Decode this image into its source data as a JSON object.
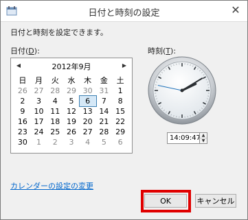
{
  "window": {
    "title": "日付と時刻の設定",
    "close_glyph": "✕"
  },
  "instruction": "日付と時刻を設定できます。",
  "date_label": {
    "text": "日付(",
    "accel": "D",
    "tail": "):"
  },
  "time_label": {
    "text": "時刻(",
    "accel": "T",
    "tail": "):"
  },
  "calendar": {
    "month_title": "2012年9月",
    "prev_glyph": "◀",
    "next_glyph": "▶",
    "weekdays": [
      "日",
      "月",
      "火",
      "水",
      "木",
      "金",
      "土"
    ],
    "weeks": [
      [
        "26",
        "27",
        "28",
        "29",
        "30",
        "31",
        "1"
      ],
      [
        "2",
        "3",
        "4",
        "5",
        "6",
        "7",
        "8"
      ],
      [
        "9",
        "10",
        "11",
        "12",
        "13",
        "14",
        "15"
      ],
      [
        "16",
        "17",
        "18",
        "19",
        "20",
        "21",
        "22"
      ],
      [
        "23",
        "24",
        "25",
        "26",
        "27",
        "28",
        "29"
      ],
      [
        "30",
        "1",
        "2",
        "3",
        "4",
        "5",
        "6"
      ]
    ],
    "selected_day": "6"
  },
  "time": {
    "value": "14:09:47",
    "up_glyph": "▲",
    "down_glyph": "▼"
  },
  "change_calendar_link": "カレンダーの設定の変更",
  "buttons": {
    "ok": "OK",
    "cancel": "キャンセル"
  },
  "highlight_color": "#e00000"
}
